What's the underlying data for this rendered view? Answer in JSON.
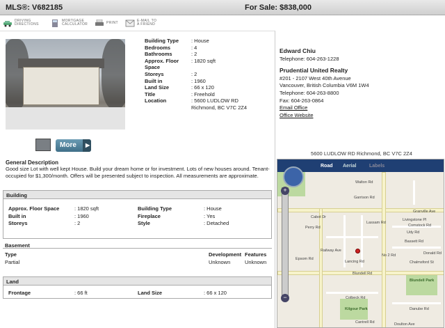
{
  "header": {
    "mls": "MLS®: V682185",
    "sale": "For Sale: $838,000"
  },
  "toolbar": [
    {
      "icon": "car-icon",
      "l1": "DRIVING",
      "l2": "DIRECTIONS"
    },
    {
      "icon": "calculator-icon",
      "l1": "MORTGAGE",
      "l2": "CALCULATOR"
    },
    {
      "icon": "printer-icon",
      "l1": "PRINT",
      "l2": ""
    },
    {
      "icon": "envelope-icon",
      "l1": "E-MAIL TO",
      "l2": "A FRIEND"
    }
  ],
  "more_label": "More",
  "more_arrow": "▶",
  "specs": [
    {
      "k": "Building Type",
      "v": ": House"
    },
    {
      "k": "Bedrooms",
      "v": ": 4"
    },
    {
      "k": "Bathrooms",
      "v": ": 2"
    },
    {
      "k": "Approx. Floor Space",
      "v": ": 1820 sqft"
    },
    {
      "k": "Storeys",
      "v": ": 2"
    },
    {
      "k": "Built in",
      "v": ": 1960"
    },
    {
      "k": "Land Size",
      "v": ": 66 x 120"
    },
    {
      "k": "Title",
      "v": ": Freehold"
    },
    {
      "k": "Location",
      "v": ": 5600 LUDLOW RD Richmond, BC V7C 2Z4"
    }
  ],
  "agent": {
    "name": "Edward Chiu",
    "phone": "Telephone: 604-263-1228",
    "company": "Prudential United Realty",
    "addr1": "#201 - 2107 West 40th Avenue",
    "addr2": "Vancouver, British Columbia V6M 1W4",
    "tel": "Telephone: 604-263-8800",
    "fax": "Fax: 604-263-0864",
    "email": "Email Office",
    "website": "Office Website"
  },
  "general": {
    "title": "General Description",
    "body": "Good size Lot with well kept House. Build your dream home or for investment. Lots of new houses around. Tenant-occupied for $1,300/month. Offers will be presented subject to inspection. All measurements are approximate."
  },
  "building": {
    "title": "Building",
    "left": [
      {
        "k": "Approx. Floor Space",
        "v": ": 1820 sqft"
      },
      {
        "k": "Built in",
        "v": ": 1960"
      },
      {
        "k": "Storeys",
        "v": ": 2"
      }
    ],
    "right": [
      {
        "k": "Building Type",
        "v": ": House"
      },
      {
        "k": "Fireplace",
        "v": ": Yes"
      },
      {
        "k": "Style",
        "v": ": Detached"
      }
    ]
  },
  "basement": {
    "title": "Basement",
    "type_label": "Type",
    "type_value": "Partial",
    "dev_label": "Development",
    "dev_value": "Unknown",
    "feat_label": "Features",
    "feat_value": "Unknown"
  },
  "land": {
    "title": "Land",
    "frontage_k": "Frontage",
    "frontage_v": ": 66 ft",
    "size_k": "Land Size",
    "size_v": ": 66 x 120"
  },
  "map": {
    "title": "5600 LUDLOW RD Richmond, BC V7C 2Z4",
    "tabs": [
      "Road",
      "Aerial",
      "Labels"
    ],
    "zoom_in": "+",
    "zoom_out": "−",
    "labels": [
      "Walton Rd",
      "Garrison Rd",
      "Granville Ave",
      "Livingstone Pl",
      "Comstock Rd",
      "Udy Rd",
      "Bassett Rd",
      "Donald Rd",
      "Chalmsford St",
      "Blundell Rd",
      "Lancing Rd",
      "Colbeck Rd",
      "Cantrell Rd",
      "Danube Rd",
      "Doulton Ave",
      "Kilgour Park",
      "Blundell Park",
      "Cabot Dr",
      "Perry Rd",
      "No 2 Rd",
      "Lassam Rd",
      "Railway Ave",
      "Epsom Rd"
    ]
  }
}
